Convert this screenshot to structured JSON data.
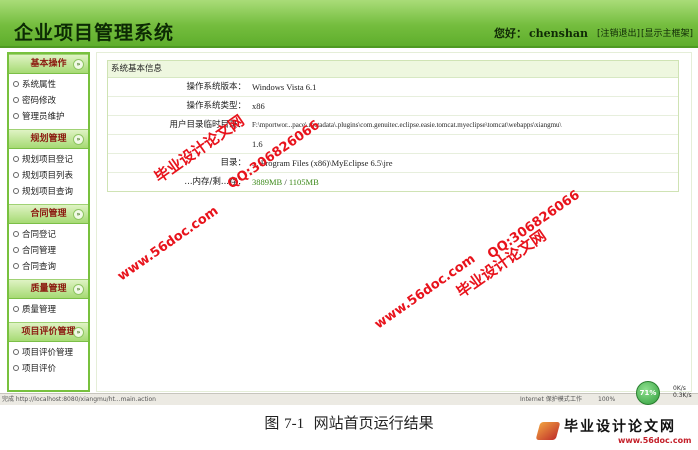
{
  "header": {
    "app_title": "企业项目管理系统",
    "greeting_label": "您好：",
    "username": "chenshan",
    "logout_link": "[注销退出]",
    "home_link": "[显示主框架]"
  },
  "sidebar": {
    "sections": [
      {
        "title": "基本操作",
        "items": [
          "系统属性",
          "密码修改",
          "管理员维护"
        ]
      },
      {
        "title": "规划管理",
        "items": [
          "规划项目登记",
          "规划项目列表",
          "规划项目查询"
        ]
      },
      {
        "title": "合同管理",
        "items": [
          "合同登记",
          "合同管理",
          "合同查询"
        ]
      },
      {
        "title": "质量管理",
        "items": [
          "质量管理"
        ]
      },
      {
        "title": "项目评价管理",
        "items": [
          "项目评价管理",
          "项目评价"
        ]
      }
    ],
    "toggle_icon": "chevron-icon"
  },
  "main": {
    "panel_title": "系统基本信息",
    "rows": [
      {
        "label": "操作系统版本：",
        "value": "Windows Vista  6.1"
      },
      {
        "label": "操作系统类型：",
        "value": "x86"
      },
      {
        "label": "用户目录临时目录：",
        "value": "F:\\mportwor...pace\\.metadata\\.plugins\\com.genuitec.eclipse.easie.tomcat.myeclipse\\tomcat\\webapps\\xiangmu\\"
      },
      {
        "label": "",
        "value": "1.6"
      },
      {
        "label": "目录：",
        "value": "...\\Program Files (x86)\\MyEclipse 6.5\\jre"
      },
      {
        "label": "...内存/剩...存：",
        "value_used": "3889MB",
        "value_sep": " / ",
        "value_free": "1105MB"
      }
    ]
  },
  "statusbar": {
    "left_text": "完成  http://localhost:8080/xiangmu/ht...main.action",
    "mid1": "Internet 保护模式",
    "mid2": "工作",
    "mid3": "100%",
    "progress_pct": "71%",
    "speed_up": "0K/s",
    "speed_down": "0.3K/s"
  },
  "watermarks": {
    "site": "www.56doc.com",
    "qq": "QQ:306826066",
    "brand": "毕业设计论文网"
  },
  "caption": {
    "label": "图",
    "number": "7-1",
    "text": "网站首页运行结果"
  },
  "corner_logo": {
    "title": "毕业设计论文网",
    "url": "www.56doc.com"
  }
}
